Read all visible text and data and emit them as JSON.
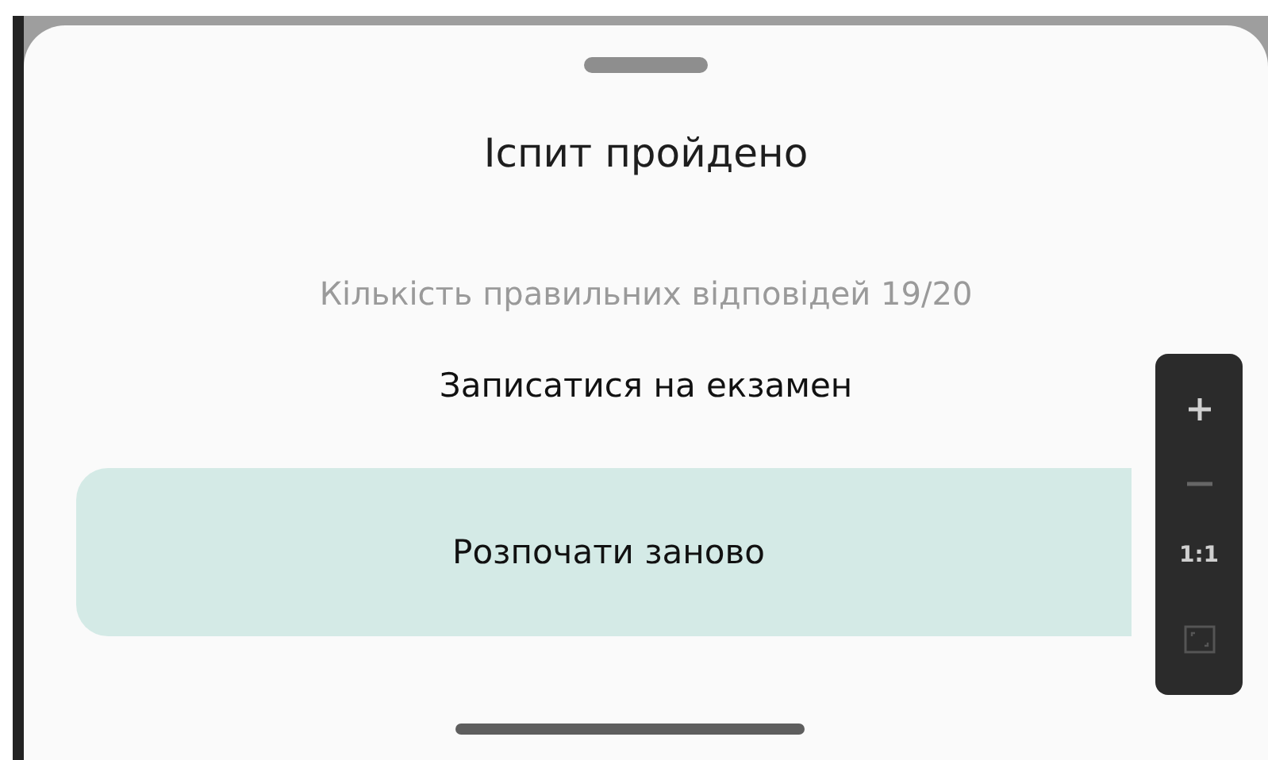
{
  "sheet": {
    "title": "Іспит пройдено",
    "result": "Кількість правильних відповідей 19/20",
    "link": "Записатися на екзамен",
    "button": "Розпочати заново"
  },
  "zoom_controls": {
    "ratio": "1:1"
  }
}
